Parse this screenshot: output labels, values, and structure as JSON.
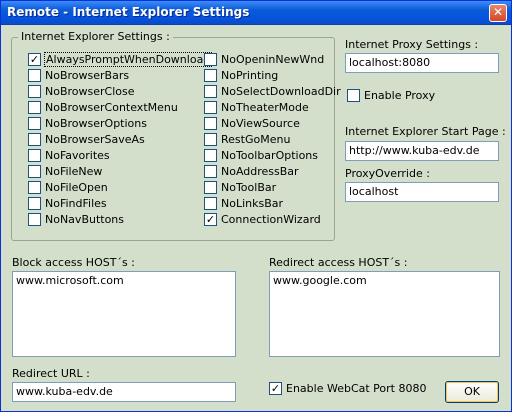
{
  "window": {
    "title": "Remote - Internet Explorer Settings",
    "close_glyph": "✕"
  },
  "ie_settings": {
    "group_label": "Internet Explorer Settings :",
    "left_column": [
      {
        "label": "AlwaysPromptWhenDownload",
        "checked": true
      },
      {
        "label": "NoBrowserBars",
        "checked": false
      },
      {
        "label": "NoBrowserClose",
        "checked": false
      },
      {
        "label": "NoBrowserContextMenu",
        "checked": false
      },
      {
        "label": "NoBrowserOptions",
        "checked": false
      },
      {
        "label": "NoBrowserSaveAs",
        "checked": false
      },
      {
        "label": "NoFavorites",
        "checked": false
      },
      {
        "label": "NoFileNew",
        "checked": false
      },
      {
        "label": "NoFileOpen",
        "checked": false
      },
      {
        "label": "NoFindFiles",
        "checked": false
      },
      {
        "label": "NoNavButtons",
        "checked": false
      }
    ],
    "right_column": [
      {
        "label": "NoOpeninNewWnd",
        "checked": false
      },
      {
        "label": "NoPrinting",
        "checked": false
      },
      {
        "label": "NoSelectDownloadDir",
        "checked": false
      },
      {
        "label": "NoTheaterMode",
        "checked": false
      },
      {
        "label": "NoViewSource",
        "checked": false
      },
      {
        "label": "RestGoMenu",
        "checked": false
      },
      {
        "label": "NoToolbarOptions",
        "checked": false
      },
      {
        "label": "NoAddressBar",
        "checked": false
      },
      {
        "label": "NoToolBar",
        "checked": false
      },
      {
        "label": "NoLinksBar",
        "checked": false
      },
      {
        "label": "ConnectionWizard",
        "checked": true
      }
    ]
  },
  "proxy": {
    "label": "Internet Proxy Settings :",
    "value": "localhost:8080",
    "enable_label": "Enable Proxy",
    "enable_checked": false
  },
  "start_page": {
    "label": "Internet Explorer Start Page :",
    "value": "http://www.kuba-edv.de"
  },
  "proxy_override": {
    "label": "ProxyOverride :",
    "value": "localhost"
  },
  "block_hosts": {
    "label": "Block access HOST´s :",
    "value": "www.microsoft.com"
  },
  "redirect_hosts": {
    "label": "Redirect access HOST´s :",
    "value": "www.google.com"
  },
  "redirect_url": {
    "label": "Redirect URL :",
    "value": "www.kuba-edv.de"
  },
  "webcat": {
    "label": "Enable WebCat Port 8080",
    "checked": true
  },
  "ok_label": "OK",
  "check_glyph": "✓"
}
